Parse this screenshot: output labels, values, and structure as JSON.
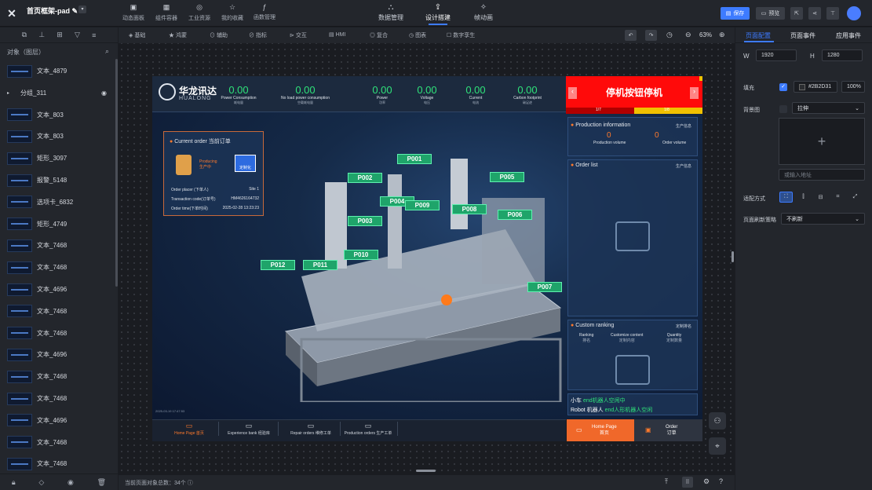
{
  "app": {
    "title": "首页框架-pad",
    "nav": [
      "动态面板",
      "组件容器",
      "工业资源",
      "我的收藏",
      "函数管理"
    ],
    "center_tabs": [
      "数据管理",
      "设计搭建",
      "帧动画"
    ],
    "active_tab": "设计搭建",
    "save": "保存",
    "preview": "预览"
  },
  "left_panel": {
    "header": "对象（图层）",
    "items": [
      "文本_4879",
      "分组_311",
      "文本_803",
      "文本_803",
      "矩形_3097",
      "报警_5148",
      "选项卡_6832",
      "矩形_4749",
      "文本_7468",
      "文本_7468",
      "文本_4696",
      "文本_7468",
      "文本_7468",
      "文本_4696",
      "文本_7468",
      "文本_7468",
      "文本_4696",
      "文本_7468",
      "文本_7468"
    ]
  },
  "toolbar": {
    "items": [
      "基础",
      "鸿蒙",
      "辅助",
      "指标",
      "交互",
      "HMI",
      "复合",
      "图表",
      "数字孪生"
    ],
    "zoom": "63%"
  },
  "right_panel": {
    "tabs": [
      "页面配置",
      "页面事件",
      "应用事件"
    ],
    "w_label": "W",
    "w": "1920",
    "h_label": "H",
    "h": "1280",
    "fill_label": "填充",
    "fill_color": "#2B2D31",
    "fill_opacity": "100%",
    "bg_label": "背景图",
    "bg_mode": "拉伸",
    "url_placeholder": "或输入地址",
    "fit_label": "适配方式",
    "refresh_label": "页面刷新策略",
    "refresh_value": "不刷新"
  },
  "status": {
    "count": "当前页面对象总数：34个"
  },
  "art": {
    "brand": "华龙讯达",
    "brand_en": "HUALONG",
    "metrics": [
      {
        "v": "0.00",
        "l": "Power Consumption",
        "z": "耗电量"
      },
      {
        "v": "0.00",
        "l": "No load power consumption",
        "z": "空载耗电量"
      },
      {
        "v": "0.00",
        "l": "Power",
        "z": "功率"
      },
      {
        "v": "0.00",
        "l": "Voltage",
        "z": "电压"
      },
      {
        "v": "0.00",
        "l": "Current",
        "z": "电流"
      },
      {
        "v": "0.00",
        "l": "Carbon footprint",
        "z": "碳足迹"
      }
    ],
    "alarm": "停机按钮停机",
    "alarm_page": "1/7",
    "alarm_page2": "1/8",
    "order": {
      "title": "Current order 当前订单",
      "producing": "Producing",
      "producing_zh": "生产中",
      "badge": "定制化",
      "rows": [
        [
          "Order placer (下单人)",
          "Site 1"
        ],
        [
          "Transaction code(订单号)",
          "HM4626164732"
        ],
        [
          "Order time(下单时间)",
          "2025-02-28 13:23:23"
        ]
      ]
    },
    "prod": {
      "title": "Production information",
      "title_zh": "生产信息",
      "a": "0",
      "a_l": "Production volume",
      "a_z": "生产量",
      "b": "0",
      "b_l": "Order volume",
      "b_z": "订单量"
    },
    "orderlist": {
      "title": "Order list",
      "title_zh": "生产信息"
    },
    "ranking": {
      "title": "Custom ranking",
      "title_zh": "定制排名",
      "cols": [
        [
          "Ranking",
          "排名"
        ],
        [
          "Customize content",
          "定制内容"
        ],
        [
          "Quantity",
          "定制数量"
        ]
      ]
    },
    "robots": [
      [
        "小车",
        "end机器人空闲中"
      ],
      [
        "Robot 机器人",
        "end人形机器人空闲"
      ]
    ],
    "tags": [
      "P001",
      "P002",
      "P003",
      "P004",
      "P005",
      "P006",
      "P007",
      "P008",
      "P009",
      "P010",
      "P011",
      "P012"
    ],
    "bottom_nav": [
      [
        "Home Page",
        "首页"
      ],
      [
        "Experience bank",
        "经验库"
      ],
      [
        "Repair orders",
        "维修工单"
      ],
      [
        "Production orders",
        "生产工单"
      ]
    ],
    "right_nav": [
      [
        "Home Page",
        "首页"
      ],
      [
        "Order",
        "订单"
      ]
    ],
    "timestamp": "2025-03-19 17:47:53"
  }
}
